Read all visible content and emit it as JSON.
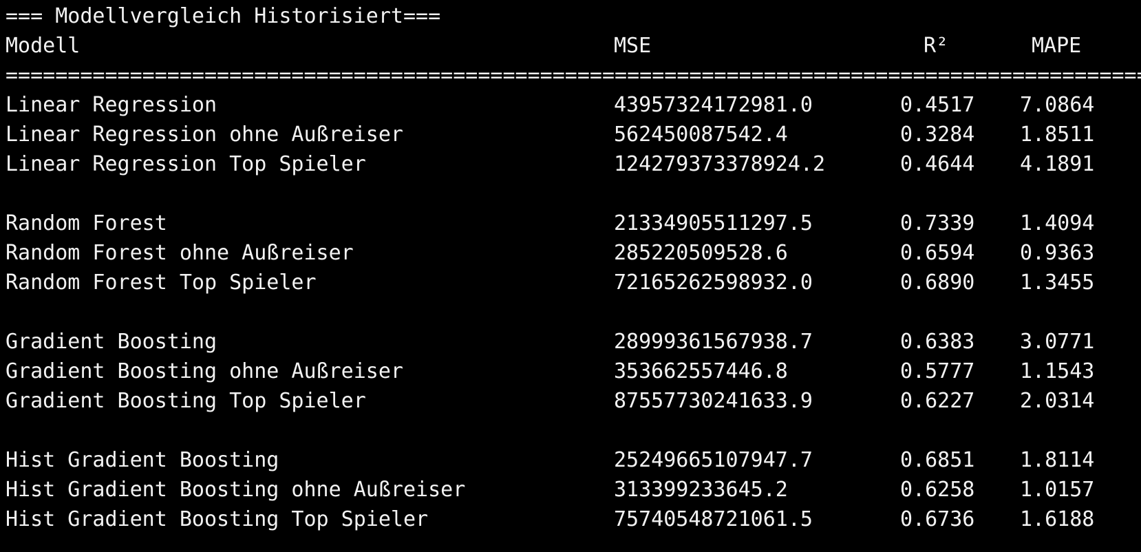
{
  "title": "=== Modellvergleich Historisiert===",
  "header": {
    "model": "Modell",
    "mse": "MSE",
    "r2": "R²",
    "mape": "MAPE"
  },
  "separator": "================================================================================================================",
  "groups": [
    {
      "rows": [
        {
          "model": "Linear Regression",
          "mse": "43957324172981.0",
          "r2": "0.4517",
          "mape": "7.0864"
        },
        {
          "model": "Linear Regression ohne Außreiser",
          "mse": "562450087542.4",
          "r2": "0.3284",
          "mape": "1.8511"
        },
        {
          "model": "Linear Regression Top Spieler",
          "mse": "124279373378924.2",
          "r2": "0.4644",
          "mape": "4.1891"
        }
      ]
    },
    {
      "rows": [
        {
          "model": "Random Forest",
          "mse": "21334905511297.5",
          "r2": "0.7339",
          "mape": "1.4094"
        },
        {
          "model": "Random Forest ohne Außreiser",
          "mse": "285220509528.6",
          "r2": "0.6594",
          "mape": "0.9363"
        },
        {
          "model": "Random Forest Top Spieler",
          "mse": "72165262598932.0",
          "r2": "0.6890",
          "mape": "1.3455"
        }
      ]
    },
    {
      "rows": [
        {
          "model": "Gradient Boosting",
          "mse": "28999361567938.7",
          "r2": "0.6383",
          "mape": "3.0771"
        },
        {
          "model": "Gradient Boosting ohne Außreiser",
          "mse": "353662557446.8",
          "r2": "0.5777",
          "mape": "1.1543"
        },
        {
          "model": "Gradient Boosting Top Spieler",
          "mse": "87557730241633.9",
          "r2": "0.6227",
          "mape": "2.0314"
        }
      ]
    },
    {
      "rows": [
        {
          "model": "Hist Gradient Boosting",
          "mse": "25249665107947.7",
          "r2": "0.6851",
          "mape": "1.8114"
        },
        {
          "model": "Hist Gradient Boosting ohne Außreiser",
          "mse": "313399233645.2",
          "r2": "0.6258",
          "mape": "1.0157"
        },
        {
          "model": "Hist Gradient Boosting Top Spieler",
          "mse": "75740548721061.5",
          "r2": "0.6736",
          "mape": "1.6188"
        }
      ]
    }
  ]
}
